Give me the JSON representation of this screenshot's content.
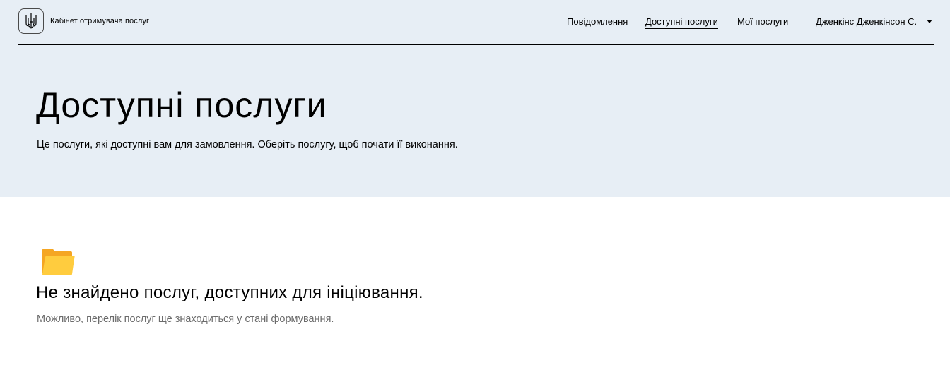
{
  "header": {
    "logo_text": "Кабінет отримувача послуг",
    "nav": [
      {
        "label": "Повідомлення",
        "active": false
      },
      {
        "label": "Доступні послуги",
        "active": true
      },
      {
        "label": "Мої послуги",
        "active": false
      }
    ],
    "user_name": "Дженкінс Дженкінсон С.",
    "icons": {
      "logo": "trident-icon",
      "user_menu": "caret-down-icon"
    }
  },
  "hero": {
    "title": "Доступні послуги",
    "subtitle": "Це послуги, які доступні вам для замовлення. Оберіть послугу, щоб почати її виконання."
  },
  "empty_state": {
    "icon": "folder-icon",
    "title": "Не знайдено послуг, доступних для ініціювання.",
    "text": "Можливо, перелік послуг ще знаходиться у стані формування."
  },
  "colors": {
    "hero_bg": "#e7eef5",
    "folder": "#ffcc3e",
    "muted_text": "#6b6b6b"
  }
}
